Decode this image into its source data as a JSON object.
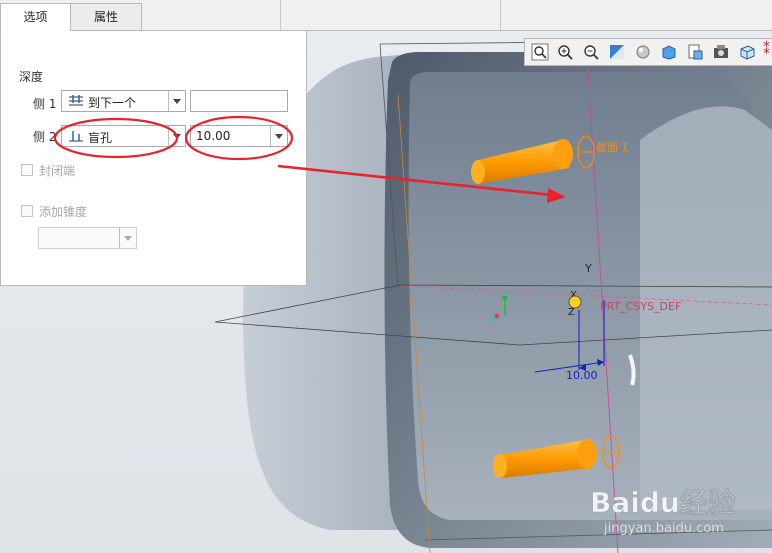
{
  "tabs": [
    {
      "label": "选项",
      "active": true
    },
    {
      "label": "属性",
      "active": false
    }
  ],
  "options": {
    "depth_heading": "深度",
    "side1": {
      "label": "侧 1",
      "depth_option": "到下一个",
      "value": ""
    },
    "side2": {
      "label": "侧 2",
      "depth_option": "盲孔",
      "value": "10.00"
    },
    "closed_ends": {
      "label": "封闭端",
      "checked": false,
      "enabled": false
    },
    "add_taper": {
      "label": "添加锥度",
      "checked": false,
      "enabled": false,
      "value": ""
    }
  },
  "toolbar": {
    "icons": [
      "refit-zoom-icon",
      "zoom-in-icon",
      "zoom-out-icon",
      "repaint-icon",
      "display-style-icon",
      "saved-views-icon",
      "view-manager-icon",
      "perspective-view-icon",
      "datum-display-icon"
    ]
  },
  "model": {
    "section_label": "截面 1",
    "csys_label": "PRT_CSYS_DEF",
    "axis_y": "Y",
    "axis_z": "Z",
    "axis_x": "X",
    "depth_dimension": "10.00"
  },
  "watermark": {
    "brand": "Baidu经验",
    "url": "jingyan.baidu.com"
  },
  "colors": {
    "annotation_red": "#e8232d",
    "feature_orange": "#ff9a00",
    "model_gray": "#a9b2bf",
    "dimension_blue": "#1020c8"
  }
}
